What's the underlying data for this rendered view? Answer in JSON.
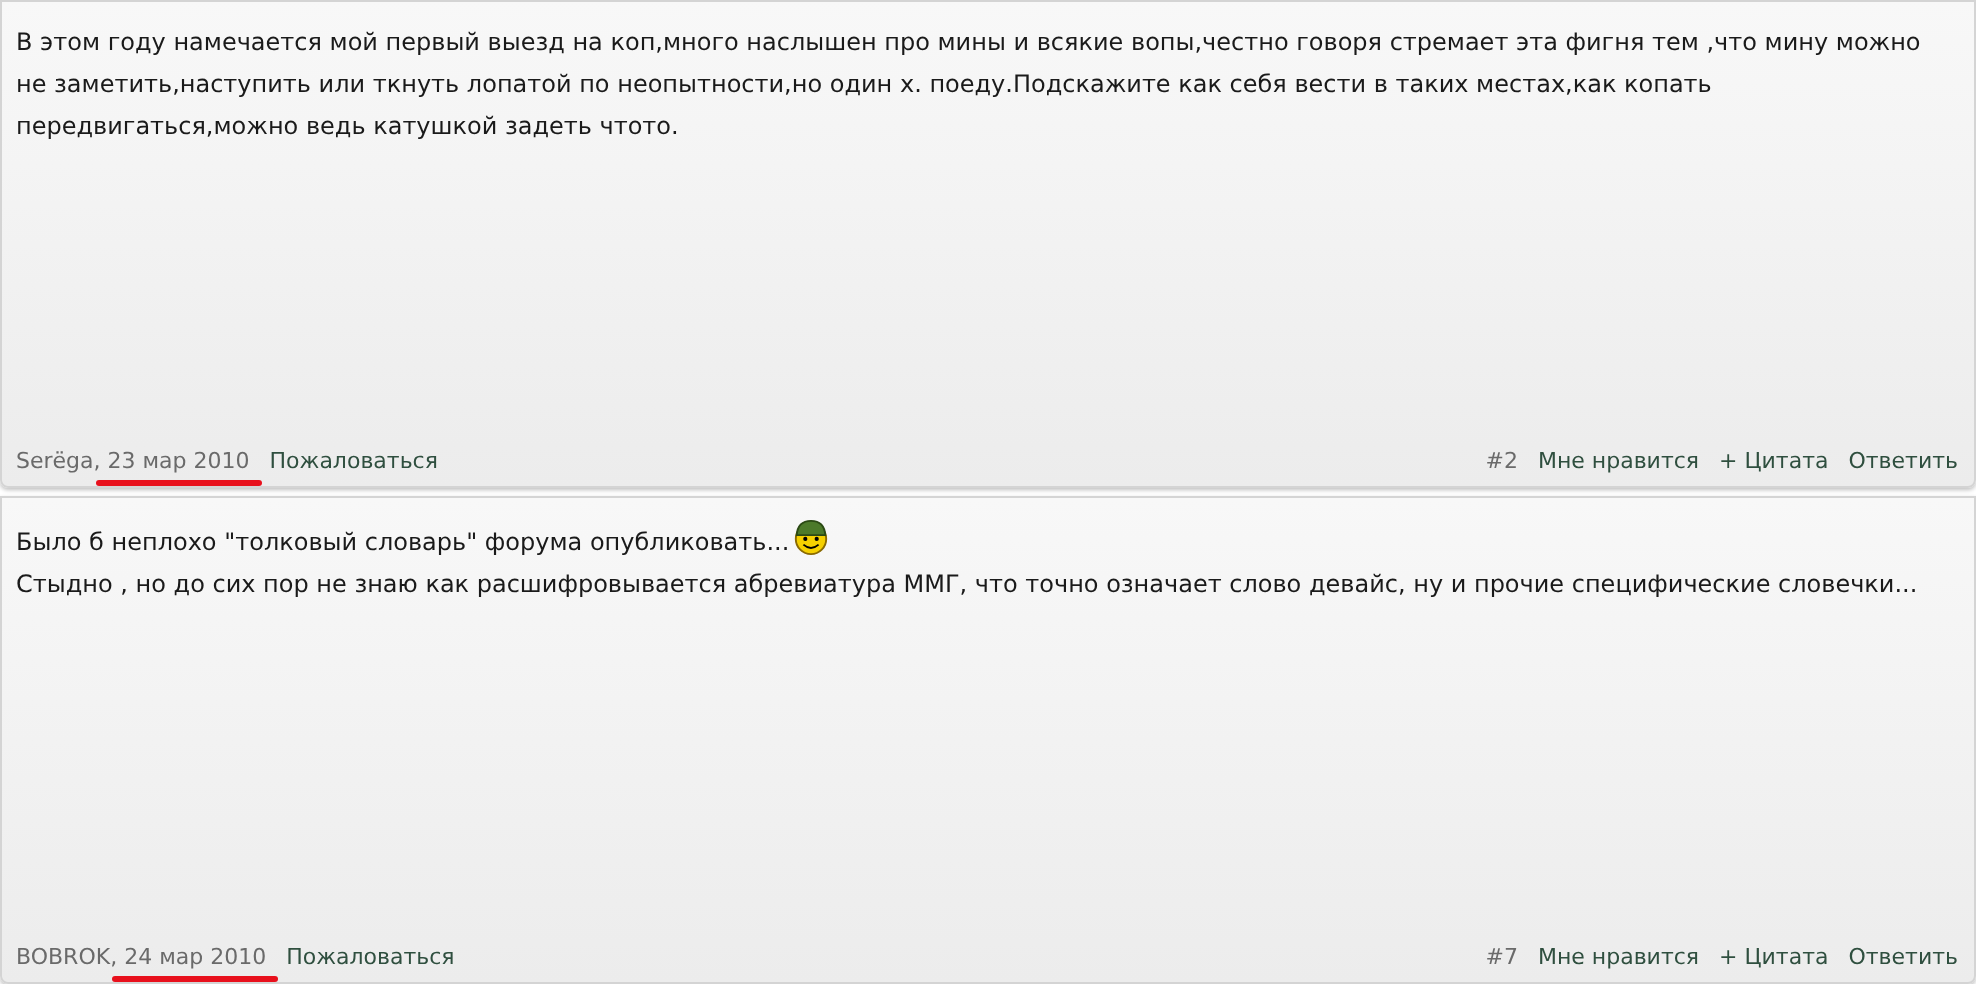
{
  "posts": [
    {
      "message": [
        {
          "text": "В этом году намечается мой первый выезд на коп,много наслышен про мины и всякие вопы,честно говоря стремает эта фигня тем ,что мину можно не заметить,наступить или ткнуть лопатой по неопытности,но один х. поеду.Подскажите как себя вести в таких местах,как копать передвигаться,можно ведь катушкой задеть чтото.",
          "smiley": false
        }
      ],
      "author": "Serёga",
      "separator": ",",
      "date": "23 мар 2010",
      "date_underlined": true,
      "report": "Пожаловаться",
      "number": "#2",
      "actions": [
        "Мне нравится",
        "+ Цитата",
        "Ответить"
      ]
    },
    {
      "message": [
        {
          "text": "Было б неплохо \"толковый словарь\" форума опубликовать...",
          "smiley": true
        },
        {
          "text": "Стыдно , но до сих пор не знаю как расшифровывается абревиатура ММГ, что точно означает слово девайс, ну и прочие специфические словечки...",
          "smiley": false
        }
      ],
      "author": "BOBROK",
      "separator": ",",
      "date": "24 мар 2010",
      "date_underlined": true,
      "report": "Пожаловаться",
      "number": "#7",
      "actions": [
        "Мне нравится",
        "+ Цитата",
        "Ответить"
      ]
    }
  ]
}
